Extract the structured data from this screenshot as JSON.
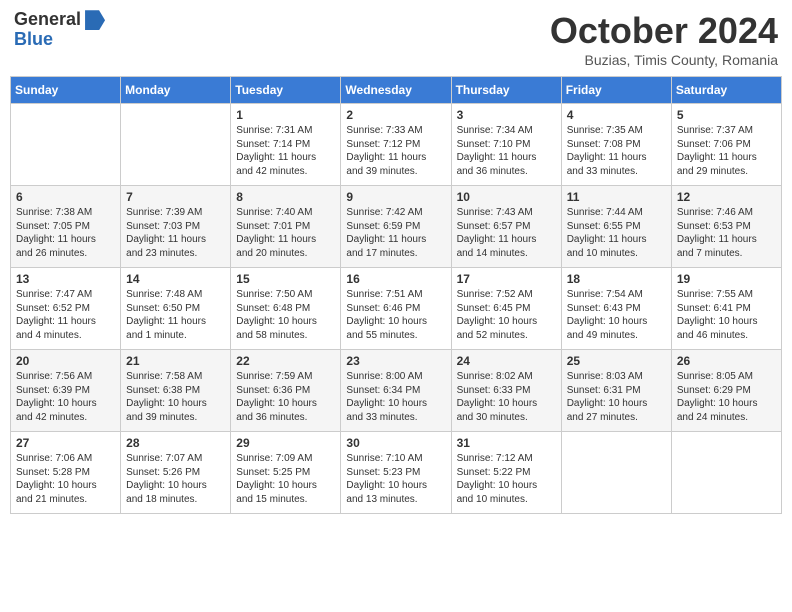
{
  "header": {
    "logo_general": "General",
    "logo_blue": "Blue",
    "title": "October 2024",
    "subtitle": "Buzias, Timis County, Romania"
  },
  "weekdays": [
    "Sunday",
    "Monday",
    "Tuesday",
    "Wednesday",
    "Thursday",
    "Friday",
    "Saturday"
  ],
  "weeks": [
    [
      {
        "day": "",
        "info": ""
      },
      {
        "day": "",
        "info": ""
      },
      {
        "day": "1",
        "info": "Sunrise: 7:31 AM\nSunset: 7:14 PM\nDaylight: 11 hours and 42 minutes."
      },
      {
        "day": "2",
        "info": "Sunrise: 7:33 AM\nSunset: 7:12 PM\nDaylight: 11 hours and 39 minutes."
      },
      {
        "day": "3",
        "info": "Sunrise: 7:34 AM\nSunset: 7:10 PM\nDaylight: 11 hours and 36 minutes."
      },
      {
        "day": "4",
        "info": "Sunrise: 7:35 AM\nSunset: 7:08 PM\nDaylight: 11 hours and 33 minutes."
      },
      {
        "day": "5",
        "info": "Sunrise: 7:37 AM\nSunset: 7:06 PM\nDaylight: 11 hours and 29 minutes."
      }
    ],
    [
      {
        "day": "6",
        "info": "Sunrise: 7:38 AM\nSunset: 7:05 PM\nDaylight: 11 hours and 26 minutes."
      },
      {
        "day": "7",
        "info": "Sunrise: 7:39 AM\nSunset: 7:03 PM\nDaylight: 11 hours and 23 minutes."
      },
      {
        "day": "8",
        "info": "Sunrise: 7:40 AM\nSunset: 7:01 PM\nDaylight: 11 hours and 20 minutes."
      },
      {
        "day": "9",
        "info": "Sunrise: 7:42 AM\nSunset: 6:59 PM\nDaylight: 11 hours and 17 minutes."
      },
      {
        "day": "10",
        "info": "Sunrise: 7:43 AM\nSunset: 6:57 PM\nDaylight: 11 hours and 14 minutes."
      },
      {
        "day": "11",
        "info": "Sunrise: 7:44 AM\nSunset: 6:55 PM\nDaylight: 11 hours and 10 minutes."
      },
      {
        "day": "12",
        "info": "Sunrise: 7:46 AM\nSunset: 6:53 PM\nDaylight: 11 hours and 7 minutes."
      }
    ],
    [
      {
        "day": "13",
        "info": "Sunrise: 7:47 AM\nSunset: 6:52 PM\nDaylight: 11 hours and 4 minutes."
      },
      {
        "day": "14",
        "info": "Sunrise: 7:48 AM\nSunset: 6:50 PM\nDaylight: 11 hours and 1 minute."
      },
      {
        "day": "15",
        "info": "Sunrise: 7:50 AM\nSunset: 6:48 PM\nDaylight: 10 hours and 58 minutes."
      },
      {
        "day": "16",
        "info": "Sunrise: 7:51 AM\nSunset: 6:46 PM\nDaylight: 10 hours and 55 minutes."
      },
      {
        "day": "17",
        "info": "Sunrise: 7:52 AM\nSunset: 6:45 PM\nDaylight: 10 hours and 52 minutes."
      },
      {
        "day": "18",
        "info": "Sunrise: 7:54 AM\nSunset: 6:43 PM\nDaylight: 10 hours and 49 minutes."
      },
      {
        "day": "19",
        "info": "Sunrise: 7:55 AM\nSunset: 6:41 PM\nDaylight: 10 hours and 46 minutes."
      }
    ],
    [
      {
        "day": "20",
        "info": "Sunrise: 7:56 AM\nSunset: 6:39 PM\nDaylight: 10 hours and 42 minutes."
      },
      {
        "day": "21",
        "info": "Sunrise: 7:58 AM\nSunset: 6:38 PM\nDaylight: 10 hours and 39 minutes."
      },
      {
        "day": "22",
        "info": "Sunrise: 7:59 AM\nSunset: 6:36 PM\nDaylight: 10 hours and 36 minutes."
      },
      {
        "day": "23",
        "info": "Sunrise: 8:00 AM\nSunset: 6:34 PM\nDaylight: 10 hours and 33 minutes."
      },
      {
        "day": "24",
        "info": "Sunrise: 8:02 AM\nSunset: 6:33 PM\nDaylight: 10 hours and 30 minutes."
      },
      {
        "day": "25",
        "info": "Sunrise: 8:03 AM\nSunset: 6:31 PM\nDaylight: 10 hours and 27 minutes."
      },
      {
        "day": "26",
        "info": "Sunrise: 8:05 AM\nSunset: 6:29 PM\nDaylight: 10 hours and 24 minutes."
      }
    ],
    [
      {
        "day": "27",
        "info": "Sunrise: 7:06 AM\nSunset: 5:28 PM\nDaylight: 10 hours and 21 minutes."
      },
      {
        "day": "28",
        "info": "Sunrise: 7:07 AM\nSunset: 5:26 PM\nDaylight: 10 hours and 18 minutes."
      },
      {
        "day": "29",
        "info": "Sunrise: 7:09 AM\nSunset: 5:25 PM\nDaylight: 10 hours and 15 minutes."
      },
      {
        "day": "30",
        "info": "Sunrise: 7:10 AM\nSunset: 5:23 PM\nDaylight: 10 hours and 13 minutes."
      },
      {
        "day": "31",
        "info": "Sunrise: 7:12 AM\nSunset: 5:22 PM\nDaylight: 10 hours and 10 minutes."
      },
      {
        "day": "",
        "info": ""
      },
      {
        "day": "",
        "info": ""
      }
    ]
  ]
}
